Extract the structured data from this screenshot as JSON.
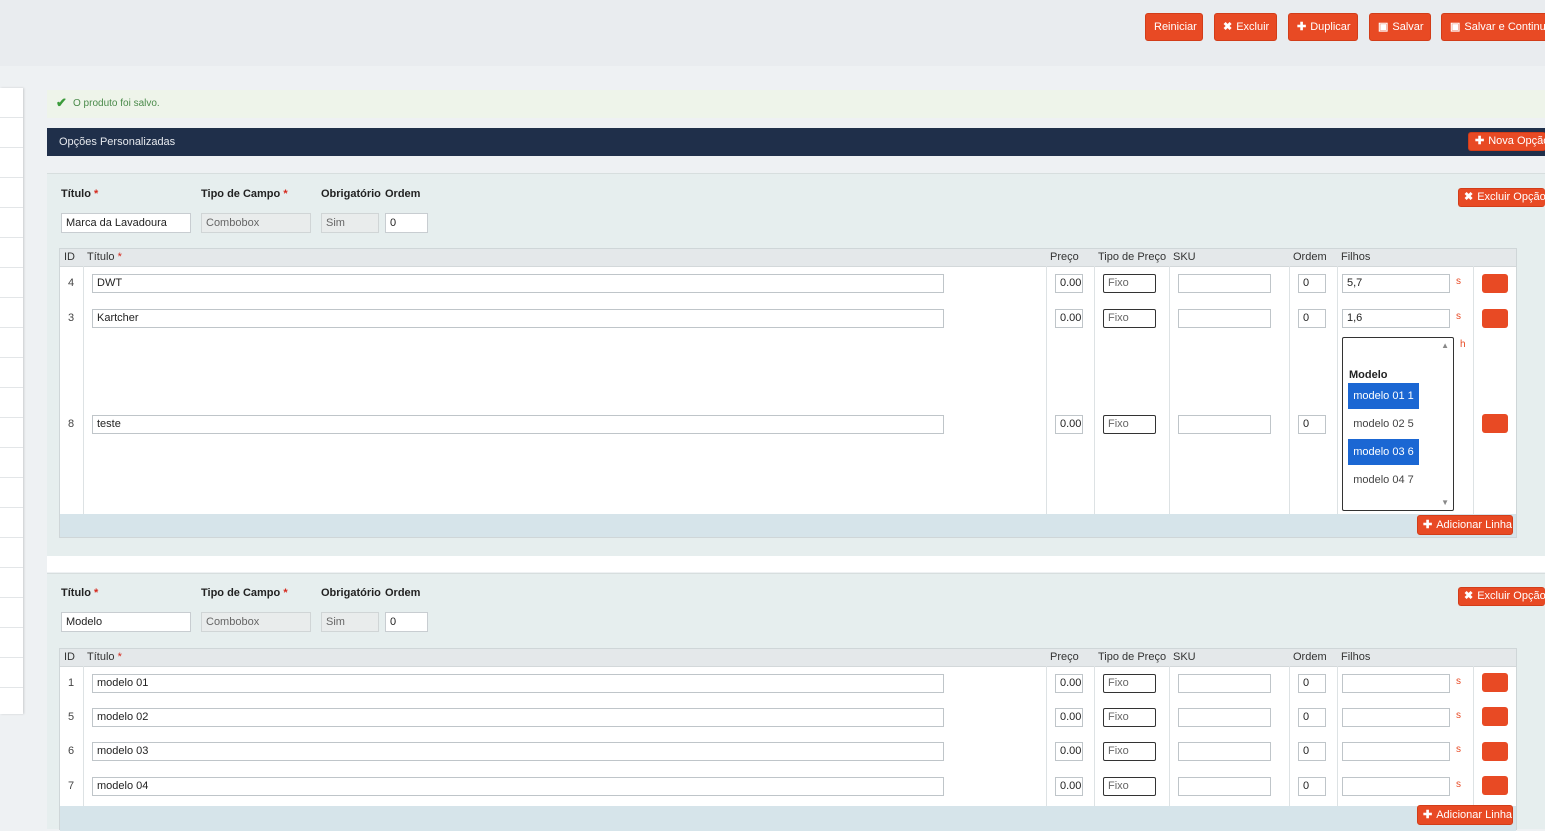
{
  "toolbar": {
    "reset": "Reiniciar",
    "delete": "Excluir",
    "duplicate": "Duplicar",
    "save": "Salvar",
    "save_continue": "Salvar e Continuar"
  },
  "message": {
    "text": "O produto foi salvo."
  },
  "section": {
    "title": "Opções Personalizadas",
    "new_option": "Nova Opção"
  },
  "labels": {
    "title": "Título",
    "field_type": "Tipo de Campo",
    "required": "Obrigatório",
    "order": "Ordem",
    "req_mark": "*",
    "delete_option": "Excluir Opção",
    "add_row": "Adicionar Linha"
  },
  "columns": {
    "id": "ID",
    "title": "Título",
    "price": "Preço",
    "price_type": "Tipo de Preço",
    "sku": "SKU",
    "order": "Ordem",
    "children": "Filhos"
  },
  "options": [
    {
      "title": "Marca da Lavadoura",
      "field_type": "Combobox",
      "required": "Sim",
      "order": "0",
      "rows": [
        {
          "id": "4",
          "title": "DWT",
          "price": "0.00",
          "price_type": "Fixo",
          "sku": "",
          "order": "0",
          "children": "5,7",
          "mark": "s"
        },
        {
          "id": "3",
          "title": "Kartcher",
          "price": "0.00",
          "price_type": "Fixo",
          "sku": "",
          "order": "0",
          "children": "1,6",
          "mark": "s"
        },
        {
          "id": "8",
          "title": "teste",
          "price": "0.00",
          "price_type": "Fixo",
          "sku": "",
          "order": "0",
          "mark": "h"
        }
      ],
      "children_select": {
        "group": "Modelo",
        "items": [
          {
            "label": "modelo 01 1",
            "selected": true
          },
          {
            "label": "modelo 02 5",
            "selected": false
          },
          {
            "label": "modelo 03 6",
            "selected": true
          },
          {
            "label": "modelo 04 7",
            "selected": false
          }
        ]
      }
    },
    {
      "title": "Modelo",
      "field_type": "Combobox",
      "required": "Sim",
      "order": "0",
      "rows": [
        {
          "id": "1",
          "title": "modelo 01",
          "price": "0.00",
          "price_type": "Fixo",
          "sku": "",
          "order": "0",
          "children": "",
          "mark": "s"
        },
        {
          "id": "5",
          "title": "modelo 02",
          "price": "0.00",
          "price_type": "Fixo",
          "sku": "",
          "order": "0",
          "children": "",
          "mark": "s"
        },
        {
          "id": "6",
          "title": "modelo 03",
          "price": "0.00",
          "price_type": "Fixo",
          "sku": "",
          "order": "0",
          "children": "",
          "mark": "s"
        },
        {
          "id": "7",
          "title": "modelo 04",
          "price": "0.00",
          "price_type": "Fixo",
          "sku": "",
          "order": "0",
          "children": "",
          "mark": "s"
        }
      ]
    }
  ],
  "colors": {
    "accent": "#e84a24",
    "header": "#1f2f4a",
    "selected": "#1b67d3",
    "success": "#3b9b3b"
  },
  "icons": {
    "check": "check-icon",
    "close": "close-icon",
    "plus": "plus-icon",
    "save": "save-icon"
  }
}
